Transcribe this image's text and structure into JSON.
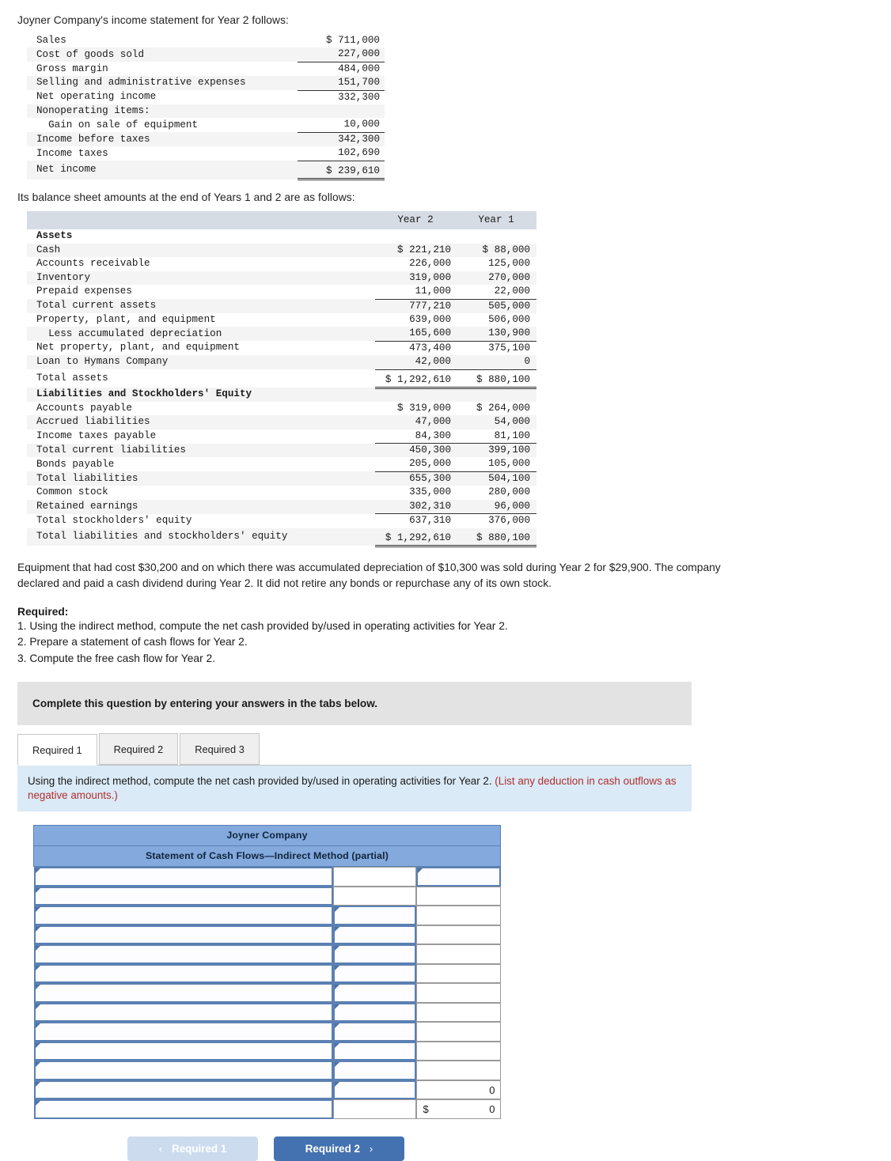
{
  "intro": {
    "income_line": "Joyner Company's income statement for Year 2 follows:",
    "balance_line": "Its balance sheet amounts at the end of Years 1 and 2 are as follows:"
  },
  "income_statement": {
    "rows": [
      {
        "label": "Sales",
        "value": "$ 711,000"
      },
      {
        "label": "Cost of goods sold",
        "value": "227,000"
      },
      {
        "label": "Gross margin",
        "value": "484,000"
      },
      {
        "label": "Selling and administrative expenses",
        "value": "151,700"
      },
      {
        "label": "Net operating income",
        "value": "332,300"
      },
      {
        "label": "Nonoperating items:",
        "value": ""
      },
      {
        "label": "  Gain on sale of equipment",
        "value": "10,000"
      },
      {
        "label": "Income before taxes",
        "value": "342,300"
      },
      {
        "label": "Income taxes",
        "value": "102,690"
      },
      {
        "label": "Net income",
        "value": "$ 239,610"
      }
    ]
  },
  "balance_sheet": {
    "col_year2": "Year 2",
    "col_year1": "Year 1",
    "rows": [
      {
        "label": "Assets",
        "year2": "",
        "year1": ""
      },
      {
        "label": "Cash",
        "year2": "$ 221,210",
        "year1": "$ 88,000"
      },
      {
        "label": "Accounts receivable",
        "year2": "226,000",
        "year1": "125,000"
      },
      {
        "label": "Inventory",
        "year2": "319,000",
        "year1": "270,000"
      },
      {
        "label": "Prepaid expenses",
        "year2": "11,000",
        "year1": "22,000"
      },
      {
        "label": "Total current assets",
        "year2": "777,210",
        "year1": "505,000"
      },
      {
        "label": "Property, plant, and equipment",
        "year2": "639,000",
        "year1": "506,000"
      },
      {
        "label": "  Less accumulated depreciation",
        "year2": "165,600",
        "year1": "130,900"
      },
      {
        "label": "Net property, plant, and equipment",
        "year2": "473,400",
        "year1": "375,100"
      },
      {
        "label": "Loan to Hymans Company",
        "year2": "42,000",
        "year1": "0"
      },
      {
        "label": "Total assets",
        "year2": "$ 1,292,610",
        "year1": "$ 880,100"
      },
      {
        "label": "Liabilities and Stockholders' Equity",
        "year2": "",
        "year1": ""
      },
      {
        "label": "Accounts payable",
        "year2": "$ 319,000",
        "year1": "$ 264,000"
      },
      {
        "label": "Accrued liabilities",
        "year2": "47,000",
        "year1": "54,000"
      },
      {
        "label": "Income taxes payable",
        "year2": "84,300",
        "year1": "81,100"
      },
      {
        "label": "Total current liabilities",
        "year2": "450,300",
        "year1": "399,100"
      },
      {
        "label": "Bonds payable",
        "year2": "205,000",
        "year1": "105,000"
      },
      {
        "label": "Total liabilities",
        "year2": "655,300",
        "year1": "504,100"
      },
      {
        "label": "Common stock",
        "year2": "335,000",
        "year1": "280,000"
      },
      {
        "label": "Retained earnings",
        "year2": "302,310",
        "year1": "96,000"
      },
      {
        "label": "Total stockholders' equity",
        "year2": "637,310",
        "year1": "376,000"
      },
      {
        "label": "Total liabilities and stockholders' equity",
        "year2": "$ 1,292,610",
        "year1": "$ 880,100"
      }
    ]
  },
  "narrative": {
    "paragraph": "Equipment that had cost $30,200 and on which there was accumulated depreciation of $10,300 was sold during Year 2 for $29,900. The company declared and paid a cash dividend during Year 2. It did not retire any bonds or repurchase any of its own stock.",
    "required_heading": "Required:",
    "requirements": [
      "1. Using the indirect method, compute the net cash provided by/used in operating activities for Year 2.",
      "2. Prepare a statement of cash flows for Year 2.",
      "3. Compute the free cash flow for Year 2."
    ]
  },
  "instruction_strip": "Complete this question by entering your answers in the tabs below.",
  "tabs": [
    {
      "label": "Required 1",
      "active": true
    },
    {
      "label": "Required 2",
      "active": false
    },
    {
      "label": "Required 3",
      "active": false
    }
  ],
  "tab_instruction": {
    "main": "Using the indirect method, compute the net cash provided by/used in operating activities for Year 2.",
    "note": "(List any deduction in cash outflows as negative amounts.)"
  },
  "answer_grid": {
    "title": "Joyner Company",
    "subtitle": "Statement of Cash Flows—Indirect Method (partial)",
    "rows": [
      {
        "label": "",
        "col2": "",
        "col3": "",
        "label_sel": true,
        "col2_sel": false,
        "col3_sel": true,
        "col3_style": ""
      },
      {
        "label": "",
        "col2": "",
        "col3": "",
        "label_sel": true,
        "col2_sel": false,
        "col3_sel": false,
        "col3_style": ""
      },
      {
        "label": "",
        "col2": "",
        "col3": "",
        "label_sel": true,
        "col2_sel": true,
        "col3_sel": false,
        "col3_style": ""
      },
      {
        "label": "",
        "col2": "",
        "col3": "",
        "label_sel": true,
        "col2_sel": true,
        "col3_sel": false,
        "col3_style": ""
      },
      {
        "label": "",
        "col2": "",
        "col3": "",
        "label_sel": true,
        "col2_sel": true,
        "col3_sel": false,
        "col3_style": ""
      },
      {
        "label": "",
        "col2": "",
        "col3": "",
        "label_sel": true,
        "col2_sel": true,
        "col3_sel": false,
        "col3_style": ""
      },
      {
        "label": "",
        "col2": "",
        "col3": "",
        "label_sel": true,
        "col2_sel": true,
        "col3_sel": false,
        "col3_style": ""
      },
      {
        "label": "",
        "col2": "",
        "col3": "",
        "label_sel": true,
        "col2_sel": true,
        "col3_sel": false,
        "col3_style": ""
      },
      {
        "label": "",
        "col2": "",
        "col3": "",
        "label_sel": true,
        "col2_sel": true,
        "col3_sel": false,
        "col3_style": ""
      },
      {
        "label": "",
        "col2": "",
        "col3": "",
        "label_sel": true,
        "col2_sel": true,
        "col3_sel": false,
        "col3_style": ""
      },
      {
        "label": "",
        "col2": "",
        "col3": "",
        "label_sel": true,
        "col2_sel": true,
        "col3_sel": false,
        "col3_style": ""
      },
      {
        "label": "",
        "col2": "",
        "col3": "0",
        "label_sel": true,
        "col2_sel": true,
        "col3_sel": false,
        "col3_style": "totline"
      },
      {
        "label": "",
        "col2": "",
        "col3": "0",
        "col3_dollar": "$",
        "label_sel": true,
        "col2_sel": false,
        "col3_sel": false,
        "col3_style": "dtotline"
      }
    ]
  },
  "nav": {
    "prev_label": "Required 1",
    "next_label": "Required 2",
    "prev_chevron": "‹",
    "next_chevron": "›"
  },
  "colors": {
    "grid_header_blue": "#83a9dd",
    "grid_header_border": "#5c81b4",
    "selected_cell_border": "#5b80b2",
    "instruction_blue": "#daeaf6",
    "note_red": "#b03030",
    "gray_strip": "#e3e3e3",
    "next_button": "#4472b0",
    "prev_button": "#ccdcee",
    "bs_header_bg": "#d6dce4",
    "row_shade": "#f4f4f4"
  }
}
